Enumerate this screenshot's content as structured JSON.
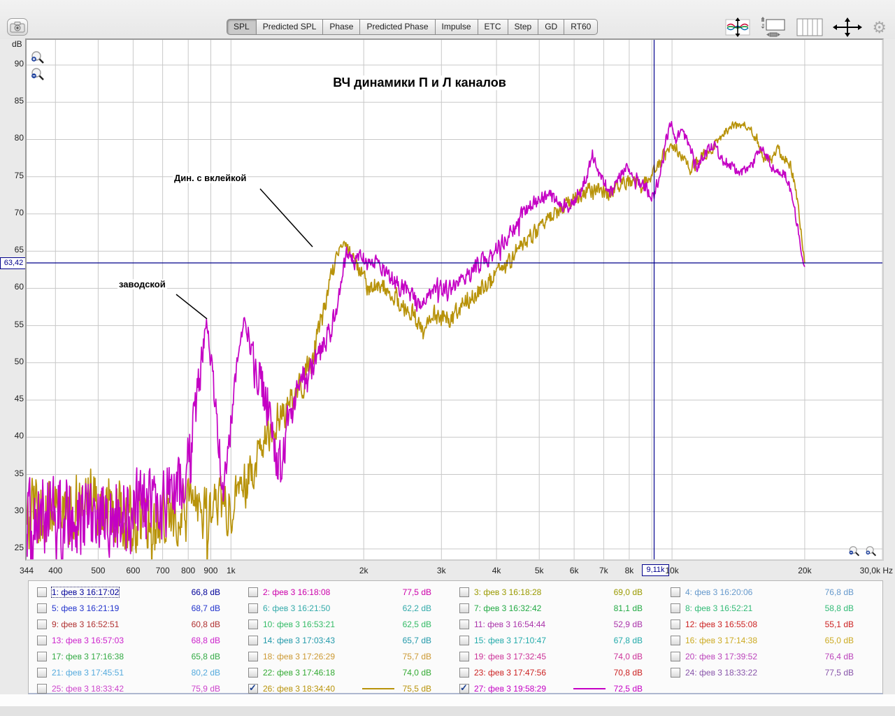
{
  "toolbar": {
    "tabs": [
      {
        "label": "SPL",
        "active": true
      },
      {
        "label": "Predicted SPL",
        "active": false
      },
      {
        "label": "Phase",
        "active": false
      },
      {
        "label": "Predicted Phase",
        "active": false
      },
      {
        "label": "Impulse",
        "active": false
      },
      {
        "label": "ETC",
        "active": false
      },
      {
        "label": "Step",
        "active": false
      },
      {
        "label": "GD",
        "active": false
      },
      {
        "label": "RT60",
        "active": false
      }
    ],
    "icons": [
      "camera-icon",
      "vertical-fit-icon",
      "graph-limits-icon",
      "grid-bars-icon",
      "pan-arrows-icon",
      "gear-icon"
    ]
  },
  "chart": {
    "title": "ВЧ динамики П и Л каналов",
    "ylabel_unit": "dB",
    "xlabel_unit": "Hz",
    "y_ticks": [
      90,
      85,
      80,
      75,
      70,
      65,
      60,
      55,
      50,
      45,
      40,
      35,
      30,
      25
    ],
    "x_ticks": [
      {
        "f": 344,
        "label": "344"
      },
      {
        "f": 400,
        "label": "400"
      },
      {
        "f": 500,
        "label": "500"
      },
      {
        "f": 600,
        "label": "600"
      },
      {
        "f": 700,
        "label": "700"
      },
      {
        "f": 800,
        "label": "800"
      },
      {
        "f": 900,
        "label": "900"
      },
      {
        "f": 1000,
        "label": "1k"
      },
      {
        "f": 2000,
        "label": "2k"
      },
      {
        "f": 3000,
        "label": "3k"
      },
      {
        "f": 4000,
        "label": "4k"
      },
      {
        "f": 5000,
        "label": "5k"
      },
      {
        "f": 6000,
        "label": "6k"
      },
      {
        "f": 7000,
        "label": "7k"
      },
      {
        "f": 8000,
        "label": "8k"
      },
      {
        "f": 10000,
        "label": "10k"
      },
      {
        "f": 20000,
        "label": "20k"
      },
      {
        "f": 30000,
        "label": "30,0k"
      }
    ],
    "cursor": {
      "db_label": "63,42",
      "freq_label": "9,11k",
      "db": 63.42,
      "freq": 9110
    },
    "annotations": [
      {
        "text": "Дин. с вклейкой"
      },
      {
        "text": "заводской"
      }
    ],
    "grid_color": "#c8c8c8",
    "cursor_color": "#00008b"
  },
  "chart_data": {
    "type": "line",
    "x_scale": "log",
    "x_range": [
      344,
      30000
    ],
    "y_range": [
      25,
      90
    ],
    "xlabel": "Hz",
    "ylabel": "dB",
    "grid": true,
    "title": "ВЧ динамики П и Л каналов",
    "note": "points are [frequency_hz, spl_db, noise_amplitude_db]; curves are noisy measurements ending at 20 kHz",
    "series": [
      {
        "name": "26: фев 3 18:34:40",
        "color": "#b8930b",
        "points": [
          [
            344,
            30,
            5
          ],
          [
            420,
            30,
            5
          ],
          [
            500,
            31,
            5
          ],
          [
            600,
            29.5,
            5
          ],
          [
            700,
            29.5,
            4.5
          ],
          [
            800,
            30,
            4.5
          ],
          [
            900,
            30,
            4
          ],
          [
            1000,
            31,
            4
          ],
          [
            1080,
            34,
            3.5
          ],
          [
            1150,
            38,
            3
          ],
          [
            1250,
            42,
            3
          ],
          [
            1350,
            44,
            2.5
          ],
          [
            1450,
            47,
            2.5
          ],
          [
            1550,
            52,
            2
          ],
          [
            1650,
            59,
            1.5
          ],
          [
            1750,
            65,
            1
          ],
          [
            1800,
            66,
            0.8
          ],
          [
            1880,
            64.5,
            1
          ],
          [
            1960,
            62.5,
            1.2
          ],
          [
            2050,
            60,
            1.4
          ],
          [
            2200,
            60.5,
            1.4
          ],
          [
            2400,
            58.5,
            1.5
          ],
          [
            2600,
            56.5,
            1.5
          ],
          [
            2750,
            54,
            1.5
          ],
          [
            2850,
            56.5,
            1.4
          ],
          [
            3000,
            56,
            1.4
          ],
          [
            3150,
            55.5,
            1.5
          ],
          [
            3350,
            58,
            1.4
          ],
          [
            3600,
            59.5,
            1.4
          ],
          [
            3900,
            61,
            1.4
          ],
          [
            4200,
            63,
            1.3
          ],
          [
            4500,
            65.5,
            1.2
          ],
          [
            4800,
            67,
            1.2
          ],
          [
            5100,
            68.5,
            1.2
          ],
          [
            5400,
            70,
            1.1
          ],
          [
            5700,
            71,
            1.1
          ],
          [
            6000,
            72,
            1.1
          ],
          [
            6400,
            73,
            1.1
          ],
          [
            6800,
            73.5,
            1.1
          ],
          [
            7200,
            72.5,
            1.1
          ],
          [
            7600,
            74,
            1.1
          ],
          [
            8000,
            74.5,
            1.1
          ],
          [
            8500,
            73.5,
            1.1
          ],
          [
            9110,
            75.5,
            1
          ],
          [
            9500,
            77.5,
            1
          ],
          [
            10000,
            79,
            0.9
          ],
          [
            10400,
            78.5,
            0.9
          ],
          [
            11000,
            76,
            1
          ],
          [
            11600,
            77.5,
            1
          ],
          [
            12200,
            78.5,
            0.9
          ],
          [
            12900,
            80.5,
            0.8
          ],
          [
            13600,
            81.5,
            0.8
          ],
          [
            14300,
            82,
            0.7
          ],
          [
            15000,
            81.5,
            0.7
          ],
          [
            15600,
            80,
            0.8
          ],
          [
            16200,
            77.5,
            0.9
          ],
          [
            16800,
            77,
            0.9
          ],
          [
            17400,
            78.5,
            0.8
          ],
          [
            18000,
            77.5,
            0.8
          ],
          [
            18600,
            76.5,
            0.8
          ],
          [
            19100,
            73,
            0.7
          ],
          [
            19500,
            69,
            0.6
          ],
          [
            19800,
            65.5,
            0.4
          ],
          [
            20000,
            63.5,
            0.2
          ]
        ]
      },
      {
        "name": "27: фев 3 19:58:29",
        "color": "#c400c4",
        "points": [
          [
            344,
            29,
            6
          ],
          [
            420,
            29.5,
            6
          ],
          [
            500,
            30,
            6
          ],
          [
            600,
            30.5,
            6
          ],
          [
            700,
            31,
            5.5
          ],
          [
            760,
            33,
            5
          ],
          [
            810,
            38,
            4
          ],
          [
            850,
            48,
            3
          ],
          [
            880,
            55,
            1.5
          ],
          [
            905,
            50,
            2.5
          ],
          [
            935,
            40,
            3
          ],
          [
            960,
            33,
            2.5
          ],
          [
            985,
            38,
            2.5
          ],
          [
            1015,
            46,
            2
          ],
          [
            1045,
            52,
            1.5
          ],
          [
            1070,
            56,
            1.2
          ],
          [
            1100,
            53,
            2
          ],
          [
            1140,
            48,
            3.5
          ],
          [
            1200,
            46,
            4
          ],
          [
            1260,
            40,
            4.5
          ],
          [
            1300,
            35,
            4
          ],
          [
            1340,
            41,
            3
          ],
          [
            1390,
            45,
            2.5
          ],
          [
            1440,
            49,
            2
          ],
          [
            1490,
            47.5,
            2
          ],
          [
            1550,
            50,
            2
          ],
          [
            1620,
            52,
            1.8
          ],
          [
            1700,
            55,
            1.8
          ],
          [
            1780,
            61,
            1.5
          ],
          [
            1840,
            65,
            1.2
          ],
          [
            1900,
            63.5,
            1.2
          ],
          [
            1980,
            64.5,
            1.2
          ],
          [
            2060,
            63,
            1.2
          ],
          [
            2160,
            63.5,
            1.2
          ],
          [
            2260,
            62,
            1.2
          ],
          [
            2380,
            60.5,
            1.3
          ],
          [
            2500,
            59.5,
            1.4
          ],
          [
            2650,
            58,
            1.4
          ],
          [
            2800,
            59,
            1.4
          ],
          [
            2950,
            60.5,
            1.3
          ],
          [
            3100,
            59.5,
            1.4
          ],
          [
            3300,
            61,
            1.3
          ],
          [
            3500,
            62,
            1.3
          ],
          [
            3700,
            63.5,
            1.3
          ],
          [
            3900,
            64.5,
            1.3
          ],
          [
            4100,
            66,
            1.2
          ],
          [
            4350,
            68,
            1.2
          ],
          [
            4600,
            70,
            1.2
          ],
          [
            4900,
            71.5,
            1.1
          ],
          [
            5200,
            72.5,
            1.1
          ],
          [
            5500,
            72,
            1.1
          ],
          [
            5800,
            71,
            1.1
          ],
          [
            6100,
            72.5,
            1.1
          ],
          [
            6400,
            75,
            1
          ],
          [
            6600,
            78,
            0.9
          ],
          [
            6800,
            76,
            1
          ],
          [
            7000,
            74,
            1
          ],
          [
            7300,
            73,
            1.1
          ],
          [
            7600,
            75,
            1
          ],
          [
            7900,
            76.5,
            1
          ],
          [
            8200,
            75,
            1
          ],
          [
            8600,
            74,
            1
          ],
          [
            8900,
            72.8,
            1
          ],
          [
            9110,
            72.5,
            1
          ],
          [
            9400,
            75.5,
            1
          ],
          [
            9700,
            80,
            0.9
          ],
          [
            9950,
            82.5,
            0.7
          ],
          [
            10200,
            80,
            0.9
          ],
          [
            10600,
            81,
            0.8
          ],
          [
            11000,
            79,
            0.9
          ],
          [
            11400,
            76.5,
            1
          ],
          [
            11900,
            78,
            0.9
          ],
          [
            12400,
            79.5,
            0.9
          ],
          [
            12900,
            77.5,
            0.9
          ],
          [
            13500,
            76.5,
            0.9
          ],
          [
            14100,
            76,
            0.9
          ],
          [
            14700,
            75.5,
            0.9
          ],
          [
            15300,
            77,
            0.9
          ],
          [
            15900,
            79,
            0.8
          ],
          [
            16500,
            77.5,
            0.8
          ],
          [
            17100,
            75.5,
            0.9
          ],
          [
            17700,
            76,
            0.8
          ],
          [
            18300,
            74.5,
            0.8
          ],
          [
            18800,
            72,
            0.8
          ],
          [
            19300,
            68,
            0.6
          ],
          [
            19700,
            64.5,
            0.4
          ],
          [
            20000,
            62.8,
            0.2
          ]
        ]
      }
    ]
  },
  "legend": {
    "items": [
      {
        "label": "1: фев 3 16:17:02",
        "value": "66,8 dB",
        "color": "#000099",
        "checked": false,
        "focused": true
      },
      {
        "label": "2: фев 3 16:18:08",
        "value": "77,5 dB",
        "color": "#cc00aa",
        "checked": false
      },
      {
        "label": "3: фев 3 16:18:28",
        "value": "69,0 dB",
        "color": "#9a9a00",
        "checked": false
      },
      {
        "label": "4: фев 3 16:20:06",
        "value": "76,8 dB",
        "color": "#6699cc",
        "checked": false
      },
      {
        "label": "5: фев 3 16:21:19",
        "value": "68,7 dB",
        "color": "#2233cc",
        "checked": false
      },
      {
        "label": "6: фев 3 16:21:50",
        "value": "62,2 dB",
        "color": "#33aaaa",
        "checked": false
      },
      {
        "label": "7: фев 3 16:32:42",
        "value": "81,1 dB",
        "color": "#22aa44",
        "checked": false
      },
      {
        "label": "8: фев 3 16:52:21",
        "value": "58,8 dB",
        "color": "#33bb77",
        "checked": false
      },
      {
        "label": "9: фев 3 16:52:51",
        "value": "60,8 dB",
        "color": "#b03030",
        "checked": false
      },
      {
        "label": "10: фев 3 16:53:21",
        "value": "62,5 dB",
        "color": "#33bb66",
        "checked": false
      },
      {
        "label": "11: фев 3 16:54:44",
        "value": "52,9 dB",
        "color": "#aa33aa",
        "checked": false
      },
      {
        "label": "12: фев 3 16:55:08",
        "value": "55,1 dB",
        "color": "#cc2222",
        "checked": false
      },
      {
        "label": "13: фев 3 16:57:03",
        "value": "68,8 dB",
        "color": "#cc22cc",
        "checked": false
      },
      {
        "label": "14: фев 3 17:03:43",
        "value": "65,7 dB",
        "color": "#2299aa",
        "checked": false
      },
      {
        "label": "15: фев 3 17:10:47",
        "value": "67,8 dB",
        "color": "#22aaaa",
        "checked": false
      },
      {
        "label": "16: фев 3 17:14:38",
        "value": "65,0 dB",
        "color": "#ccaa22",
        "checked": false
      },
      {
        "label": "17: фев 3 17:16:38",
        "value": "65,8 dB",
        "color": "#33aa44",
        "checked": false
      },
      {
        "label": "18: фев 3 17:26:29",
        "value": "75,7 dB",
        "color": "#cc9933",
        "checked": false
      },
      {
        "label": "19: фев 3 17:32:45",
        "value": "74,0 dB",
        "color": "#cc3399",
        "checked": false
      },
      {
        "label": "20: фев 3 17:39:52",
        "value": "76,4 dB",
        "color": "#bb44bb",
        "checked": false
      },
      {
        "label": "21: фев 3 17:45:51",
        "value": "80,2 dB",
        "color": "#55aadd",
        "checked": false
      },
      {
        "label": "22: фев 3 17:46:18",
        "value": "74,0 dB",
        "color": "#33aa33",
        "checked": false
      },
      {
        "label": "23: фев 3 17:47:56",
        "value": "70,8 dB",
        "color": "#cc2222",
        "checked": false
      },
      {
        "label": "24: фев 3 18:33:22",
        "value": "77,5 dB",
        "color": "#8855aa",
        "checked": false
      },
      {
        "label": "25: фев 3 18:33:42",
        "value": "75,9 dB",
        "color": "#cc44cc",
        "checked": false
      },
      {
        "label": "26: фев 3 18:34:40",
        "value": "75,5 dB",
        "color": "#b8930b",
        "checked": true
      },
      {
        "label": "27: фев 3 19:58:29",
        "value": "72,5 dB",
        "color": "#c400c4",
        "checked": true
      }
    ]
  }
}
